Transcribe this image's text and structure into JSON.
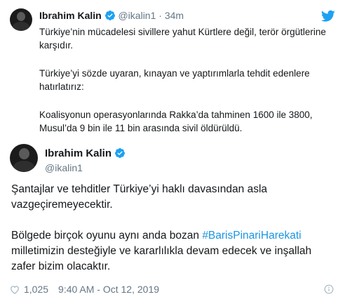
{
  "quoted": {
    "name": "Ibrahim Kalin",
    "handle": "@ikalin1",
    "dot": "·",
    "time": "34m",
    "lines": [
      "Türkiye’nin mücadelesi sivillere yahut Kürtlere değil, terör örgütlerine karşıdır.",
      "Türkiye’yi sözde uyaran, kınayan ve yaptırımlarla tehdit edenlere hatırlatırız:",
      "Koalisyonun operasyonlarında Rakka’da tahminen 1600 ile 3800, Musul’da 9 bin ile 11 bin arasında sivil öldürüldü."
    ]
  },
  "tweet": {
    "name": "Ibrahim Kalin",
    "handle": "@ikalin1",
    "paragraph1": "Şantajlar ve tehditler Türkiye’yi haklı davasından asla vazgeçiremeyecektir.",
    "p2_before": "Bölgede birçok oyunu aynı anda bozan ",
    "hashtag": "#BarisPinariHarekati",
    "p2_after": " milletimizin desteğiyle ve kararlılıkla devam edecek ve inşallah zafer bizim olacaktır.",
    "likes": "1,025",
    "timestamp": "9:40 AM - Oct 12, 2019"
  },
  "colors": {
    "link": "#1b95e0",
    "verified": "#1da1f2",
    "muted": "#657786",
    "heart": "#aab8c2"
  },
  "icons": [
    "verified-badge-icon",
    "twitter-bird-icon",
    "heart-icon",
    "info-icon"
  ]
}
